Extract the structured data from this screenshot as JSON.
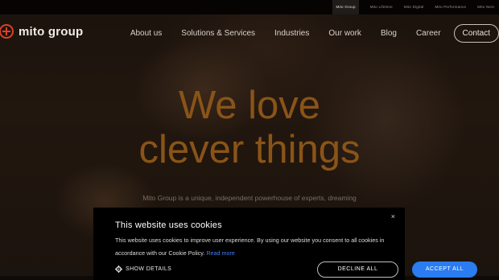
{
  "topbar": {
    "links": [
      "Mito Group",
      "Mito Lifetime",
      "Mito Digital",
      "Mito Performance",
      "Mito Next"
    ]
  },
  "logo": {
    "text": "mito group"
  },
  "nav": {
    "items": [
      "About us",
      "Solutions & Services",
      "Industries",
      "Our work",
      "Blog",
      "Career"
    ],
    "contact": "Contact"
  },
  "hero": {
    "title_line1": "We love",
    "title_line2": "clever things",
    "subtitle": "Mito Group is a unique, independent powerhouse of experts, dreaming"
  },
  "cookie_banner": {
    "title": "This website uses cookies",
    "close": "×",
    "text": "This website uses cookies to improve user experience. By using our website you consent to all cookies in accordance with our Cookie Policy.",
    "read_more": "Read more",
    "show_details": "SHOW DETAILS",
    "decline": "DECLINE ALL",
    "accept": "ACCEPT ALL"
  },
  "colors": {
    "accent": "#2a7cf0",
    "brand": "#d9412c",
    "hero_text": "#8a5418"
  }
}
